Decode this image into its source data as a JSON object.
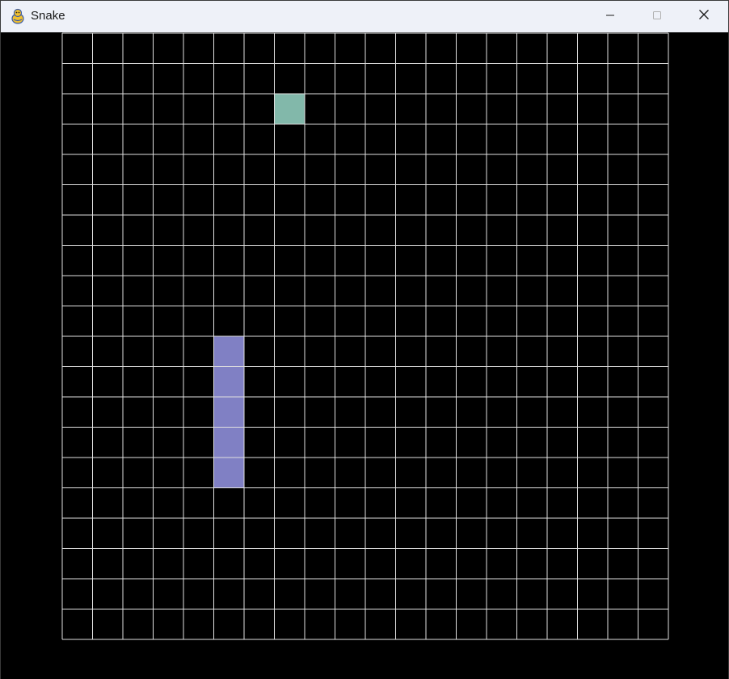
{
  "window": {
    "title": "Snake",
    "icon": "pygame-snake-icon",
    "controls": {
      "minimize": "minimize-icon",
      "maximize": "maximize-icon",
      "close": "close-icon"
    }
  },
  "game": {
    "grid": {
      "columns": 20,
      "rows": 20,
      "line_color": "#e0e0e0",
      "background": "#000000"
    },
    "snake": {
      "color": "#8080c4",
      "cells": [
        {
          "col": 5,
          "row": 10
        },
        {
          "col": 5,
          "row": 11
        },
        {
          "col": 5,
          "row": 12
        },
        {
          "col": 5,
          "row": 13
        },
        {
          "col": 5,
          "row": 14
        }
      ]
    },
    "food": {
      "color": "#82b8aa",
      "cell": {
        "col": 7,
        "row": 2
      }
    }
  }
}
